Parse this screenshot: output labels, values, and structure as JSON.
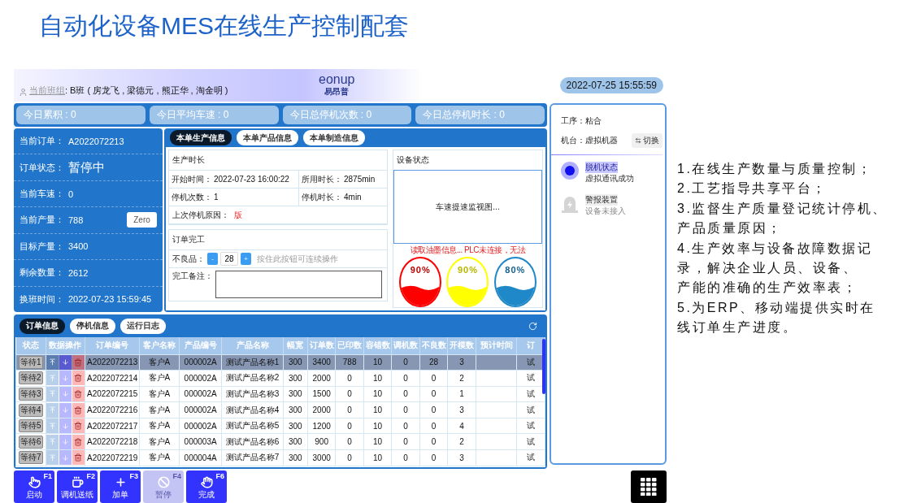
{
  "title": "自动化设备MES在线生产控制配套",
  "app": {
    "team": {
      "label": "当前班组",
      "value": ": B班 ( 房龙飞 , 梁德元 , 熊正华 , 淘金明 )"
    },
    "logo": {
      "name": "eonup",
      "subtitle": "易昂普"
    },
    "clock": "2022-07-25 15:55:59",
    "stats": [
      "今日累积 : 0",
      "今日平均车速 : 0",
      "今日总停机次数 : 0",
      "今日总停机时长 : 0"
    ],
    "order_info": [
      {
        "label": "当前订单：",
        "value": "A2022072213",
        "kind": "plain"
      },
      {
        "label": "订单状态：",
        "value": "暂停中",
        "kind": "large"
      },
      {
        "label": "当前车速：",
        "value": "0",
        "kind": "plain"
      },
      {
        "label": "当前产量：",
        "value": "788",
        "kind": "button",
        "button": "Zero"
      },
      {
        "label": "目标产量：",
        "value": "3400",
        "kind": "plain"
      },
      {
        "label": "剩余数量：",
        "value": "2612",
        "kind": "plain"
      },
      {
        "label": "换班时间：",
        "value": "2022-07-23 15:59:45",
        "kind": "plain"
      }
    ],
    "detail_tabs": [
      {
        "label": "本单生产信息",
        "selected": true
      },
      {
        "label": "本单产品信息",
        "selected": false
      },
      {
        "label": "本单制造信息",
        "selected": false
      }
    ],
    "production_time": {
      "title": "生产时长",
      "fields": [
        {
          "label": "开始时间：",
          "value": "2022-07-23 16:00:22"
        },
        {
          "label": "所用时长：",
          "value": "2875min"
        },
        {
          "label": "停机次数：",
          "value": "1"
        },
        {
          "label": "停机时长：",
          "value": "4min"
        }
      ],
      "last_stop": {
        "label": "上次停机原因：",
        "value": "版"
      }
    },
    "completion": {
      "title": "订单完工",
      "defect": {
        "label": "不良品：",
        "minus": "-",
        "value": "28",
        "plus": "+",
        "hint": "按住此按钮可连续操作"
      },
      "remark": {
        "label": "完工备注："
      }
    },
    "device": {
      "title": "设备状态",
      "monitor": "车速提速监视图...",
      "warning": "读取油墨信息... PLC未连接，无法",
      "inks": [
        {
          "reading": "90%",
          "color": "#ff0000"
        },
        {
          "reading": "90%",
          "color": "#ffff00"
        },
        {
          "reading": "80%",
          "color": "#1e88c8"
        }
      ]
    },
    "table_tabs": [
      {
        "label": "订单信息",
        "selected": true
      },
      {
        "label": "停机信息",
        "selected": false
      },
      {
        "label": "运行日志",
        "selected": false
      }
    ],
    "table": {
      "columns": [
        "状态",
        "数据操作",
        "订单编号",
        "客户名称",
        "产品编号",
        "产品名称",
        "幅宽",
        "订单数",
        "已印数",
        "容错数",
        "调机数",
        "不良数",
        "开模数",
        "预计时间",
        "订"
      ],
      "rows": [
        {
          "selected": true,
          "cells": [
            "等待1",
            "",
            "A2022072213",
            "客户A",
            "000002A",
            "测试产品名称1",
            "300",
            "3400",
            "788",
            "10",
            "0",
            "28",
            "3",
            "",
            "试"
          ]
        },
        {
          "selected": false,
          "cells": [
            "等待2",
            "",
            "A2022072214",
            "客户A",
            "000002A",
            "测试产品名称2",
            "300",
            "2000",
            "0",
            "10",
            "0",
            "0",
            "2",
            "",
            "试"
          ]
        },
        {
          "selected": false,
          "cells": [
            "等待3",
            "",
            "A2022072215",
            "客户A",
            "000002A",
            "测试产品名称3",
            "300",
            "1500",
            "0",
            "10",
            "0",
            "0",
            "1",
            "",
            "试"
          ]
        },
        {
          "selected": false,
          "cells": [
            "等待4",
            "",
            "A2022072216",
            "客户A",
            "000002A",
            "测试产品名称4",
            "300",
            "2000",
            "0",
            "10",
            "0",
            "0",
            "3",
            "",
            "试"
          ]
        },
        {
          "selected": false,
          "cells": [
            "等待5",
            "",
            "A2022072217",
            "客户A",
            "000002A",
            "测试产品名称5",
            "300",
            "1200",
            "0",
            "10",
            "0",
            "0",
            "4",
            "",
            "试"
          ]
        },
        {
          "selected": false,
          "cells": [
            "等待6",
            "",
            "A2022072218",
            "客户A",
            "000003A",
            "测试产品名称6",
            "300",
            "900",
            "0",
            "10",
            "0",
            "0",
            "2",
            "",
            "试"
          ]
        },
        {
          "selected": false,
          "cells": [
            "等待7",
            "",
            "A2022072219",
            "客户A",
            "000004A",
            "测试产品名称7",
            "300",
            "3000",
            "0",
            "10",
            "0",
            "0",
            "3",
            "",
            "试"
          ]
        }
      ]
    },
    "station": {
      "process": {
        "label": "工序：",
        "value": "粘合"
      },
      "machine": {
        "label": "机台：",
        "value": "虚拟机器"
      },
      "switch": "切换",
      "devices": [
        {
          "kind": "link",
          "name": "脱机状态",
          "status": "虚拟通讯成功",
          "active": true
        },
        {
          "kind": "alarm",
          "name": "警报装置",
          "status": "设备未接入",
          "active": false
        }
      ]
    },
    "actions": [
      {
        "kind": "start",
        "label": "启动",
        "key": "F1",
        "disabled": false
      },
      {
        "kind": "feed",
        "label": "调机送纸",
        "key": "F2",
        "disabled": false
      },
      {
        "kind": "add",
        "label": "加单",
        "key": "F3",
        "disabled": false
      },
      {
        "kind": "pause",
        "label": "暂停",
        "key": "F4",
        "disabled": true
      },
      {
        "kind": "finish",
        "label": "完成",
        "key": "F6",
        "disabled": false
      }
    ]
  },
  "notes": [
    {
      "lines": [
        "1.在线生产数量与质量控制；"
      ]
    },
    {
      "lines": [
        "2.工艺指导共享平台；"
      ]
    },
    {
      "lines": [
        "3.监督生产质量登记统计停机、",
        "产品质量原因；"
      ]
    },
    {
      "lines": [
        "4.生产效率与设备故障数据记",
        "录，解决企业人员、设备、",
        "产能的准确的生产效率表；"
      ]
    },
    {
      "lines": [
        "5.为ERP、移动端提供实时在",
        "线订单生产进度。"
      ]
    }
  ]
}
